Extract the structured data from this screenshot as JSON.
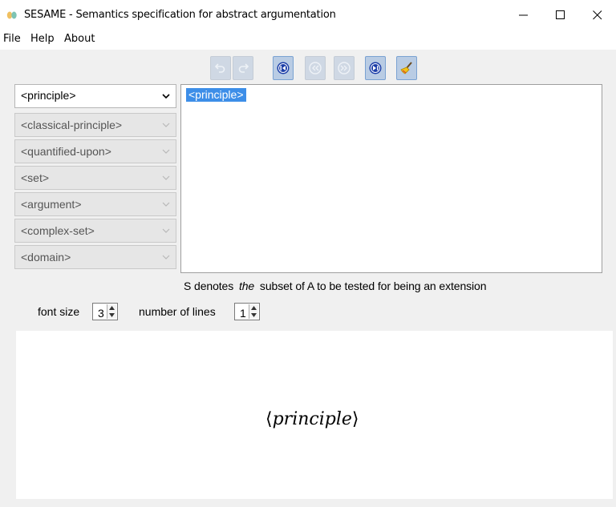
{
  "window": {
    "title": "SESAME - Semantics specification for abstract argumentation",
    "controls": [
      "minimize",
      "maximize",
      "close"
    ]
  },
  "menu": {
    "items": [
      "File",
      "Help",
      "About"
    ]
  },
  "toolbar": {
    "buttons": [
      {
        "icon": "undo-icon",
        "state": "disabled"
      },
      {
        "icon": "redo-icon",
        "state": "disabled"
      },
      {
        "icon": "first-icon",
        "state": "active"
      },
      {
        "icon": "previous-icon",
        "state": "disabled"
      },
      {
        "icon": "next-icon",
        "state": "disabled"
      },
      {
        "icon": "last-icon",
        "state": "active"
      },
      {
        "icon": "clear-brush-icon",
        "state": "active"
      }
    ]
  },
  "categories": [
    {
      "label": "<principle>",
      "selected": true
    },
    {
      "label": "<classical-principle>",
      "selected": false
    },
    {
      "label": "<quantified-upon>",
      "selected": false
    },
    {
      "label": "<set>",
      "selected": false
    },
    {
      "label": "<argument>",
      "selected": false
    },
    {
      "label": "<complex-set>",
      "selected": false
    },
    {
      "label": "<domain>",
      "selected": false
    }
  ],
  "editor": {
    "token": "<principle>"
  },
  "description": {
    "before": "S denotes",
    "emph": "the",
    "after": "subset of A to be tested for being an extension"
  },
  "options": {
    "font_size_label": "font size",
    "font_size_value": "3",
    "lines_label": "number of lines",
    "lines_value": "1"
  },
  "preview": {
    "left_bracket": "⟨",
    "formula": "principle",
    "right_bracket": "⟩"
  },
  "colors": {
    "selection": "#3d8ee8",
    "accent": "#1d3fa8"
  }
}
